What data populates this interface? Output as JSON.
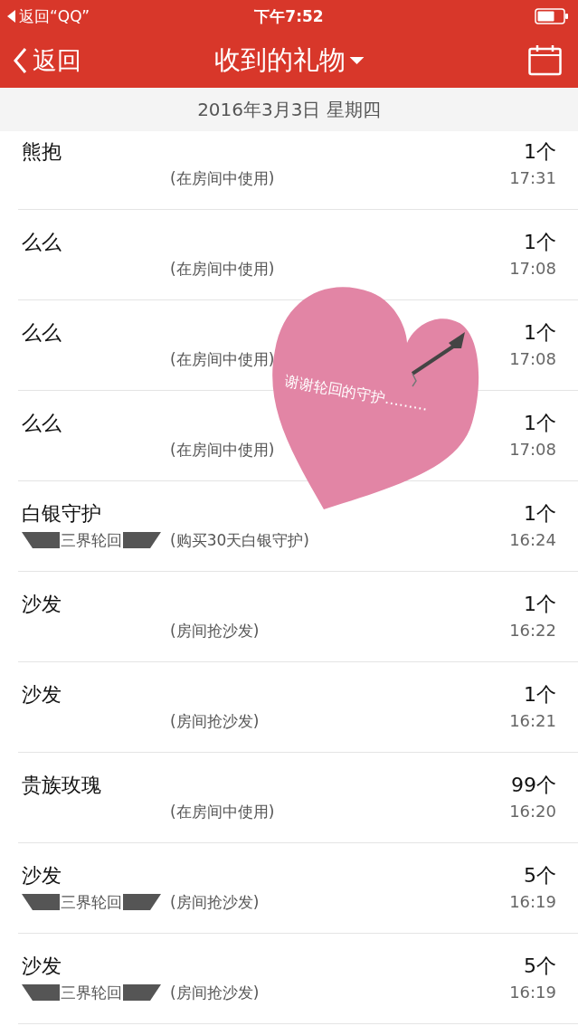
{
  "status_bar": {
    "back_app": "返回“QQ”",
    "time": "下午7:52"
  },
  "nav": {
    "back": "返回",
    "title": "收到的礼物"
  },
  "date_header": "2016年3月3日 星期四",
  "gifts": [
    {
      "name": "熊抱",
      "count": "1个",
      "note": "(在房间中使用)",
      "time": "17:31"
    },
    {
      "name": "么么",
      "count": "1个",
      "note": "(在房间中使用)",
      "time": "17:08"
    },
    {
      "name": "么么",
      "count": "1个",
      "note": "(在房间中使用)",
      "time": "17:08"
    },
    {
      "name": "么么",
      "count": "1个",
      "note": "(在房间中使用)",
      "time": "17:08"
    },
    {
      "name": "白银守护",
      "count": "1个",
      "sender": "三界轮回",
      "note": "(购买30天白银守护)",
      "time": "16:24"
    },
    {
      "name": "沙发",
      "count": "1个",
      "note": "(房间抢沙发)",
      "time": "16:22"
    },
    {
      "name": "沙发",
      "count": "1个",
      "note": "(房间抢沙发)",
      "time": "16:21"
    },
    {
      "name": "贵族玫瑰",
      "count": "99个",
      "note": "(在房间中使用)",
      "time": "16:20"
    },
    {
      "name": "沙发",
      "count": "5个",
      "sender": "三界轮回",
      "note": "(房间抢沙发)",
      "time": "16:19"
    },
    {
      "name": "沙发",
      "count": "5个",
      "sender": "三界轮回",
      "note": "(房间抢沙发)",
      "time": "16:19"
    }
  ],
  "overlay": {
    "message": "谢谢轮回的守护………"
  }
}
